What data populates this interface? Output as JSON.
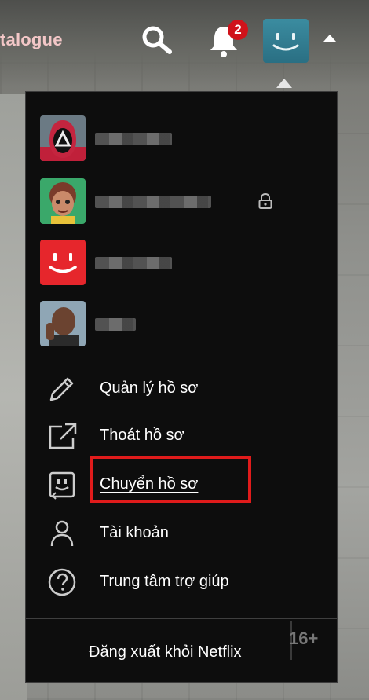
{
  "header": {
    "nav_partial_label": "talogue",
    "search_icon": "search-icon",
    "bell_icon": "bell-icon",
    "notification_count": "2",
    "avatar_icon": "smiley-avatar-icon",
    "caret_icon": "caret-up-icon"
  },
  "profiles": [
    {
      "avatar": "masked-guard-avatar",
      "locked": false
    },
    {
      "avatar": "animated-girl-avatar",
      "locked": true
    },
    {
      "avatar": "red-smiley-avatar",
      "locked": false
    },
    {
      "avatar": "man-portrait-avatar",
      "locked": false
    }
  ],
  "menu": {
    "items": [
      {
        "label": "Quản lý hồ sơ",
        "icon": "pencil-icon"
      },
      {
        "label": "Thoát hồ sơ",
        "icon": "exit-profile-icon"
      },
      {
        "label": "Chuyển hồ sơ",
        "icon": "switch-profile-icon"
      },
      {
        "label": "Tài khoản",
        "icon": "person-icon"
      },
      {
        "label": "Trung tâm trợ giúp",
        "icon": "help-icon"
      }
    ],
    "sign_out": "Đăng xuất khỏi Netflix"
  },
  "background": {
    "rating_text": "16+"
  },
  "colors": {
    "menu_bg": "#0d0d0d",
    "highlight": "#e01b1b",
    "badge": "#d0121a",
    "avatar_teal": "#2a6f83"
  }
}
